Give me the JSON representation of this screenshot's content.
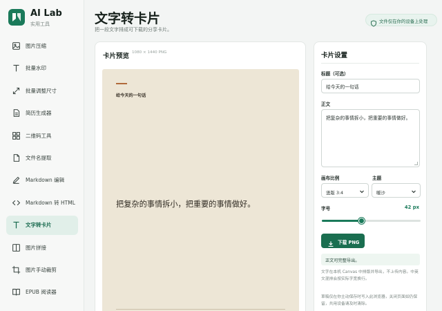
{
  "app": {
    "title": "AI Lab",
    "subtitle": "实用工具"
  },
  "sidebar": {
    "items": [
      {
        "label": "图片压缩",
        "icon": "image-icon"
      },
      {
        "label": "批量水印",
        "icon": "text-t-icon"
      },
      {
        "label": "批量调整尺寸",
        "icon": "resize-icon"
      },
      {
        "label": "简历生成器",
        "icon": "document-icon"
      },
      {
        "label": "二维码工具",
        "icon": "grid-icon"
      },
      {
        "label": "文件名提取",
        "icon": "file-icon"
      },
      {
        "label": "Markdown 编辑",
        "icon": "pen-icon"
      },
      {
        "label": "Markdown 转 HTML",
        "icon": "code-icon"
      },
      {
        "label": "文字转卡片",
        "icon": "text-t-icon",
        "active": true
      },
      {
        "label": "图片拼接",
        "icon": "columns-icon"
      },
      {
        "label": "图片手动裁剪",
        "icon": "crop-icon"
      },
      {
        "label": "EPUB 阅读器",
        "icon": "book-icon"
      }
    ]
  },
  "header": {
    "title": "文字转卡片",
    "subtitle": "把一段文字排成可下载的分享卡片。",
    "privacy_badge": "文件仅在你的设备上处理"
  },
  "preview": {
    "title": "卡片预览",
    "size_note": "1080 × 1440 PNG",
    "card": {
      "title": "给今天的一句话",
      "body": "把复杂的事情拆小，把重要的事情做好。",
      "background": "#ede6d6",
      "accent": "#b06a3a"
    }
  },
  "settings": {
    "title": "卡片设置",
    "title_label": "标题（可选）",
    "title_value": "给今天的一句话",
    "body_label": "正文",
    "body_value": "把复杂的事情拆小，把重要的事情做好。",
    "ratio_label": "画布比例",
    "ratio_value": "竖版 3:4",
    "theme_label": "主题",
    "theme_value": "暖沙",
    "font_size_label": "字号",
    "font_size_value": "42 px",
    "font_size_fraction": 0.4,
    "download_label": "下载 PNG",
    "status_text": "正文可完整导出。",
    "note1_line1": "文字在本机 Canvas 中排版并导出，不上传内容。中英",
    "note1_line2": "文混排会按实际字宽换行。",
    "note2_line1": "草稿仅在你主动保存时写入此浏览器，关闭页面如仍保",
    "note2_line2": "留，共用设备请及时清除。"
  },
  "colors": {
    "accent": "#1a7a5a",
    "active_bg": "#e1efe9"
  }
}
